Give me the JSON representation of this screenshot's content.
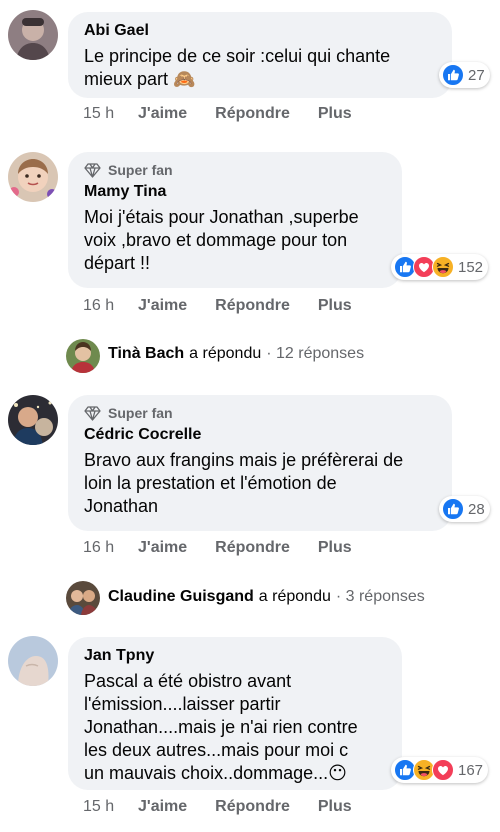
{
  "comments": [
    {
      "author": "Abi Gael",
      "super_fan": false,
      "text": "Le principe de ce soir :celui qui chante\nmieux part 🙈",
      "reactions": [
        "like"
      ],
      "reaction_count": "27",
      "time": "15 h"
    },
    {
      "author": "Mamy Tina",
      "super_fan": true,
      "text": "Moi j'étais pour Jonathan ,superbe\nvoix ,bravo et dommage pour ton\ndépart !!",
      "reactions": [
        "like",
        "love",
        "haha"
      ],
      "reaction_count": "152",
      "time": "16 h"
    },
    {
      "author": "Cédric Cocrelle",
      "super_fan": true,
      "text": "Bravo aux frangins mais je préfèrerai de\nloin la prestation et l'émotion de\nJonathan",
      "reactions": [
        "like"
      ],
      "reaction_count": "28",
      "time": "16 h"
    },
    {
      "author": "Jan Tpny",
      "super_fan": false,
      "text": "Pascal a été obistro avant\nl'émission....laisser partir\nJonathan....mais je n'ai rien contre\nles deux autres...mais pour moi c\nun mauvais choix..dommage...😶",
      "reactions": [
        "like",
        "haha",
        "love"
      ],
      "reaction_count": "167",
      "time": "15 h"
    }
  ],
  "replies": [
    {
      "name": "Tinà Bach",
      "verb": "a répondu",
      "count": "· 12 réponses"
    },
    {
      "name": "Claudine Guisgand",
      "verb": "a répondu",
      "count": "· 3 réponses"
    }
  ],
  "labels": {
    "like": "J'aime",
    "reply": "Répondre",
    "more": "Plus",
    "super_fan": "Super fan"
  },
  "colors": {
    "bubble": "#f0f2f5",
    "secondary_text": "#65676b",
    "like_blue": "#1877f2",
    "love_red": "#f33e58",
    "haha_yellow": "#f7b125"
  }
}
